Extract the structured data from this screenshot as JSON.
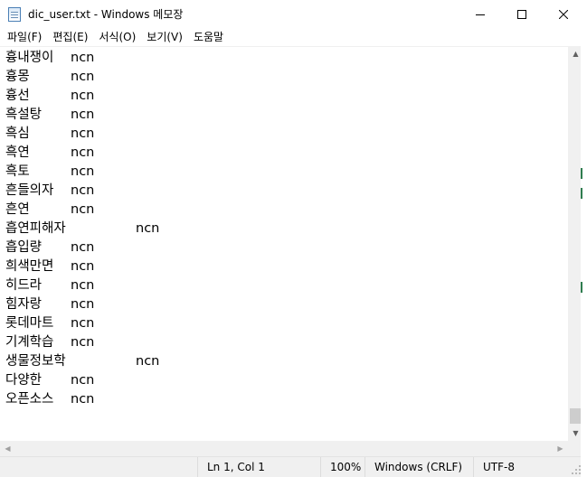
{
  "window": {
    "title": "dic_user.txt - Windows 메모장",
    "icon": "notepad-icon",
    "controls": {
      "minimize_icon": "minimize-icon",
      "maximize_icon": "maximize-icon",
      "close_icon": "close-icon"
    }
  },
  "menu": [
    "파일(F)",
    "편집(E)",
    "서식(O)",
    "보기(V)",
    "도움말"
  ],
  "lines": [
    {
      "word": "흉내쟁이",
      "tag": "ncn",
      "wide": false
    },
    {
      "word": "흉몽",
      "tag": "ncn",
      "wide": false
    },
    {
      "word": "흉선",
      "tag": "ncn",
      "wide": false
    },
    {
      "word": "흑설탕",
      "tag": "ncn",
      "wide": false
    },
    {
      "word": "흑심",
      "tag": "ncn",
      "wide": false
    },
    {
      "word": "흑연",
      "tag": "ncn",
      "wide": false
    },
    {
      "word": "흑토",
      "tag": "ncn",
      "wide": false
    },
    {
      "word": "흔들의자",
      "tag": "ncn",
      "wide": false
    },
    {
      "word": "흔연",
      "tag": "ncn",
      "wide": false
    },
    {
      "word": "흡연피해자",
      "tag": "ncn",
      "wide": true
    },
    {
      "word": "흡입량",
      "tag": "ncn",
      "wide": false
    },
    {
      "word": "희색만면",
      "tag": "ncn",
      "wide": false
    },
    {
      "word": "히드라",
      "tag": "ncn",
      "wide": false
    },
    {
      "word": "힘자랑",
      "tag": "ncn",
      "wide": false
    },
    {
      "word": "롯데마트",
      "tag": "ncn",
      "wide": false
    },
    {
      "word": "기계학습",
      "tag": "ncn",
      "wide": false
    },
    {
      "word": "생물정보학",
      "tag": "ncn",
      "wide": true
    },
    {
      "word": "다양한",
      "tag": "ncn",
      "wide": false
    },
    {
      "word": "오픈소스",
      "tag": "ncn",
      "wide": false
    }
  ],
  "status": {
    "position": "Ln 1, Col 1",
    "zoom": "100%",
    "line_ending": "Windows (CRLF)",
    "encoding": "UTF-8"
  }
}
